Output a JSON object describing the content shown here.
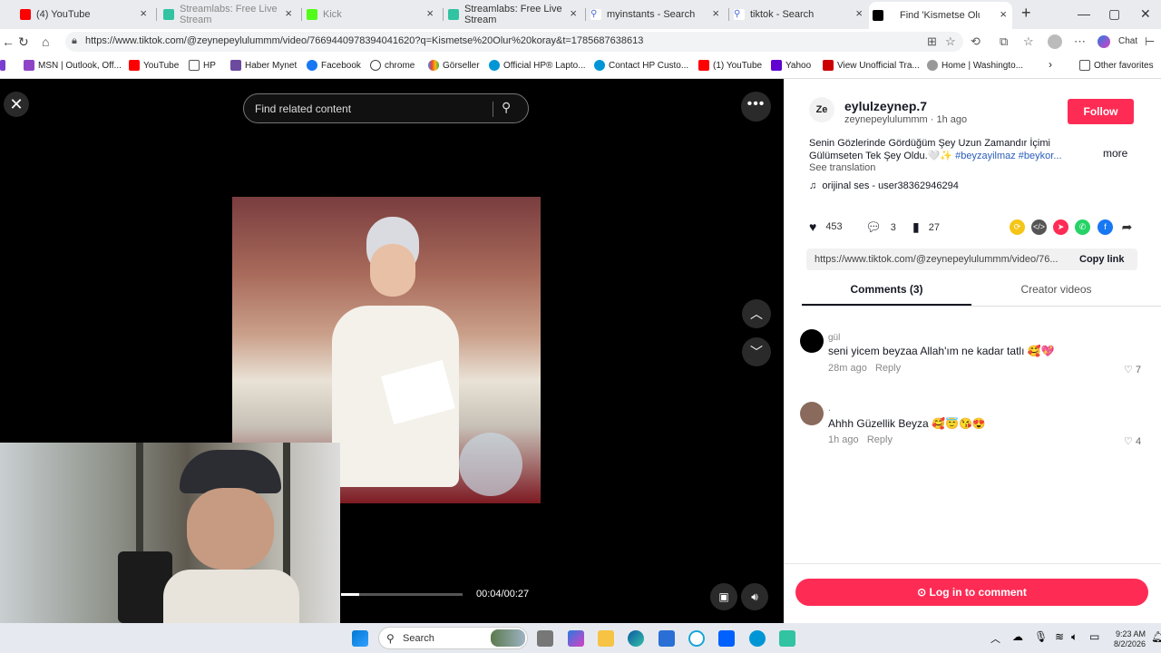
{
  "browser": {
    "tabs": [
      {
        "label": "(4) YouTube",
        "color": "#ff0000"
      },
      {
        "label": "Streamlabs: Free Live Stream",
        "color": "#31c3a2"
      },
      {
        "label": "Kick",
        "color": "#53fc18"
      },
      {
        "label": "Streamlabs: Free Live Stream",
        "color": "#31c3a2"
      },
      {
        "label": "myinstants - Search",
        "color": "#4a6ad6"
      },
      {
        "label": "tiktok - Search",
        "color": "#4a6ad6"
      },
      {
        "label": "Find 'Kismetse Olur kor",
        "color": "#000000"
      }
    ],
    "url": "https://www.tiktok.com/@zeynepeylulummm/video/7669440978394041620?q=Kismetse%20Olur%20koray&t=1785687638613",
    "profile_label": "Chat",
    "bookmarks": [
      "MSN | Outlook, Off...",
      "YouTube",
      "HP",
      "Haber Mynet",
      "Facebook",
      "chrome",
      "Görseller",
      "Official HP® Lapto...",
      "Contact HP Custo...",
      "(1) YouTube",
      "Yahoo",
      "View Unofficial Tra...",
      "Home | Washingto...",
      "Other favorites"
    ]
  },
  "player": {
    "search_placeholder": "Find related content",
    "time": "00:04/00:27",
    "progress": 0.15
  },
  "post": {
    "avatar_text": "Ze",
    "author": "eylulzeynep.7",
    "handle": "zeynepeylulummm",
    "posted": "1h ago",
    "follow_label": "Follow",
    "description": "Senin Gözlerinde Gördüğüm Şey Uzun Zamandır İçimi Gülümseten Tek Şey Oldu.🤍✨",
    "hashtags": "#beyzayilmaz #beykor...",
    "more_label": "more",
    "see_translation": "See translation",
    "music": "orijinal ses - user38362946294",
    "likes": "453",
    "comments": "3",
    "saves": "27",
    "link": "https://www.tiktok.com/@zeynepeylulummm/video/76...",
    "copy_link": "Copy link",
    "tab_comments": "Comments (3)",
    "tab_creator": "Creator videos",
    "login_label": "Log in to comment"
  },
  "comments": [
    {
      "user": "gül",
      "text": "seni yicem beyzaa Allah'ım ne kadar tatlı 🥰💖",
      "time": "28m ago",
      "reply": "Reply",
      "likes": "7"
    },
    {
      "user": ".",
      "text": "Ahhh Güzellik Beyza 🥰😇😘😍",
      "time": "1h ago",
      "reply": "Reply",
      "likes": "4"
    }
  ],
  "taskbar": {
    "search_label": "Search",
    "time": "9:23 AM",
    "date": "8/2/2026"
  }
}
